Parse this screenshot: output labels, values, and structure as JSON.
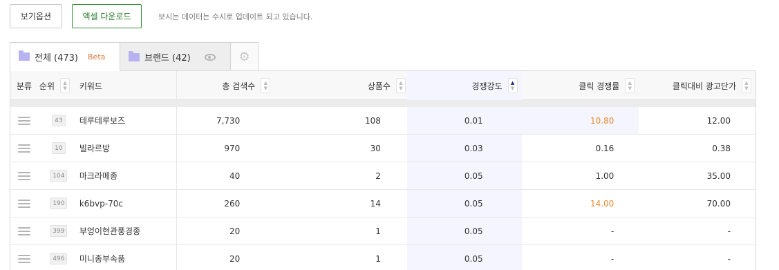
{
  "toolbar": {
    "view_options": "보기옵션",
    "excel_download": "엑셀 다운로드",
    "notice": "보시는 데이터는 수시로 업데이트 되고 있습니다."
  },
  "tabs": {
    "all": {
      "label": "전체 (473)",
      "badge": "Beta"
    },
    "brand": {
      "label": "브랜드 (42)"
    }
  },
  "icons": {
    "folder": "folder-icon",
    "eye": "eye-icon",
    "gear": "gear-icon",
    "menu": "hamburger-icon",
    "sort": "sort-arrows-icon"
  },
  "colors": {
    "excel_accent": "#3a8f3a",
    "beta": "#e0763a",
    "highlight_text": "#e8892f",
    "highlight_col": "#f4f5ff",
    "folder": "#b8b3f0"
  },
  "table": {
    "headers": {
      "category": "분류",
      "rank": "순위",
      "keyword": "키워드",
      "search": "총 검색수",
      "products": "상품수",
      "competition": "경쟁강도",
      "click_comp": "클릭 경쟁률",
      "cpc": "클릭대비 광고단가"
    },
    "sort_active": "competition",
    "rows": [
      {
        "rank": "43",
        "keyword": "테루테루보즈",
        "search": "7,730",
        "products": "108",
        "competition": "0.01",
        "click_comp": "10.80",
        "click_highlight": true,
        "cpc": "12.00"
      },
      {
        "rank": "10",
        "keyword": "빌라르방",
        "search": "970",
        "products": "30",
        "competition": "0.03",
        "click_comp": "0.16",
        "click_highlight": false,
        "cpc": "0.38"
      },
      {
        "rank": "104",
        "keyword": "마크라메종",
        "search": "40",
        "products": "2",
        "competition": "0.05",
        "click_comp": "1.00",
        "click_highlight": false,
        "cpc": "35.00"
      },
      {
        "rank": "190",
        "keyword": "k6bvp-70c",
        "search": "260",
        "products": "14",
        "competition": "0.05",
        "click_comp": "14.00",
        "click_highlight": true,
        "cpc": "70.00"
      },
      {
        "rank": "399",
        "keyword": "부엉이현관풍경종",
        "search": "20",
        "products": "1",
        "competition": "0.05",
        "click_comp": "-",
        "click_highlight": false,
        "cpc": "-"
      },
      {
        "rank": "496",
        "keyword": "미니종부속품",
        "search": "20",
        "products": "1",
        "competition": "0.05",
        "click_comp": "-",
        "click_highlight": false,
        "cpc": "-"
      }
    ]
  }
}
